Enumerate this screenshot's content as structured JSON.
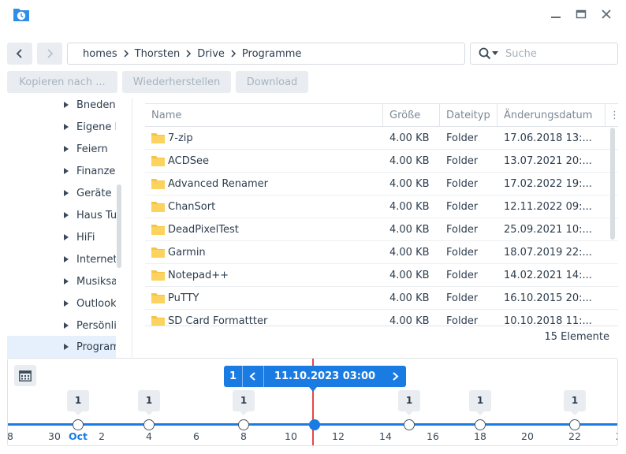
{
  "breadcrumb": [
    "homes",
    "Thorsten",
    "Drive",
    "Programme"
  ],
  "search": {
    "placeholder": "Suche"
  },
  "toolbar": {
    "copy_label": "Kopieren nach ...",
    "restore_label": "Wiederherstellen",
    "download_label": "Download"
  },
  "tree": {
    "items": [
      {
        "label": "Bneden"
      },
      {
        "label": "Eigene Dateien"
      },
      {
        "label": "Feiern"
      },
      {
        "label": "Finanzen"
      },
      {
        "label": "Geräte"
      },
      {
        "label": "Haus Tuning"
      },
      {
        "label": "HiFi"
      },
      {
        "label": "Internet"
      },
      {
        "label": "Musiksammlung"
      },
      {
        "label": "Outlook"
      },
      {
        "label": "Persönliches"
      },
      {
        "label": "Programme",
        "selected": true
      }
    ]
  },
  "table": {
    "columns": [
      "Name",
      "Größe",
      "Dateityp",
      "Änderungsdatum"
    ],
    "rows": [
      {
        "name": "7-zip",
        "size": "4.00 KB",
        "type": "Folder",
        "modified": "17.06.2018 13:..."
      },
      {
        "name": "ACDSee",
        "size": "4.00 KB",
        "type": "Folder",
        "modified": "13.07.2021 20:..."
      },
      {
        "name": "Advanced Renamer",
        "size": "4.00 KB",
        "type": "Folder",
        "modified": "17.02.2022 19:..."
      },
      {
        "name": "ChanSort",
        "size": "4.00 KB",
        "type": "Folder",
        "modified": "12.11.2022 09:..."
      },
      {
        "name": "DeadPixelTest",
        "size": "4.00 KB",
        "type": "Folder",
        "modified": "25.09.2021 10:..."
      },
      {
        "name": "Garmin",
        "size": "4.00 KB",
        "type": "Folder",
        "modified": "18.07.2019 22:..."
      },
      {
        "name": "Notepad++",
        "size": "4.00 KB",
        "type": "Folder",
        "modified": "14.02.2021 14:..."
      },
      {
        "name": "PuTTY",
        "size": "4.00 KB",
        "type": "Folder",
        "modified": "16.10.2015 20:..."
      },
      {
        "name": "SD Card Formattter",
        "size": "4.00 KB",
        "type": "Folder",
        "modified": "10.10.2018 11:..."
      }
    ]
  },
  "status": "15 Elemente",
  "timeline": {
    "count": "1",
    "current_date": "11.10.2023 03:00",
    "badges": [
      "1",
      "1",
      "1",
      "1",
      "1",
      "1"
    ],
    "ticks": [
      {
        "label": "8"
      },
      {
        "label": "30"
      },
      {
        "label": "Oct",
        "month": true
      },
      {
        "label": "2"
      },
      {
        "label": "4"
      },
      {
        "label": "6"
      },
      {
        "label": "8"
      },
      {
        "label": "10"
      },
      {
        "label": "12"
      },
      {
        "label": "14"
      },
      {
        "label": "16"
      },
      {
        "label": "18"
      },
      {
        "label": "20"
      },
      {
        "label": "22"
      },
      {
        "label": "2"
      }
    ]
  },
  "colors": {
    "accent": "#1a7ce3",
    "marker": "#e64545",
    "folder": "#f6c443"
  }
}
